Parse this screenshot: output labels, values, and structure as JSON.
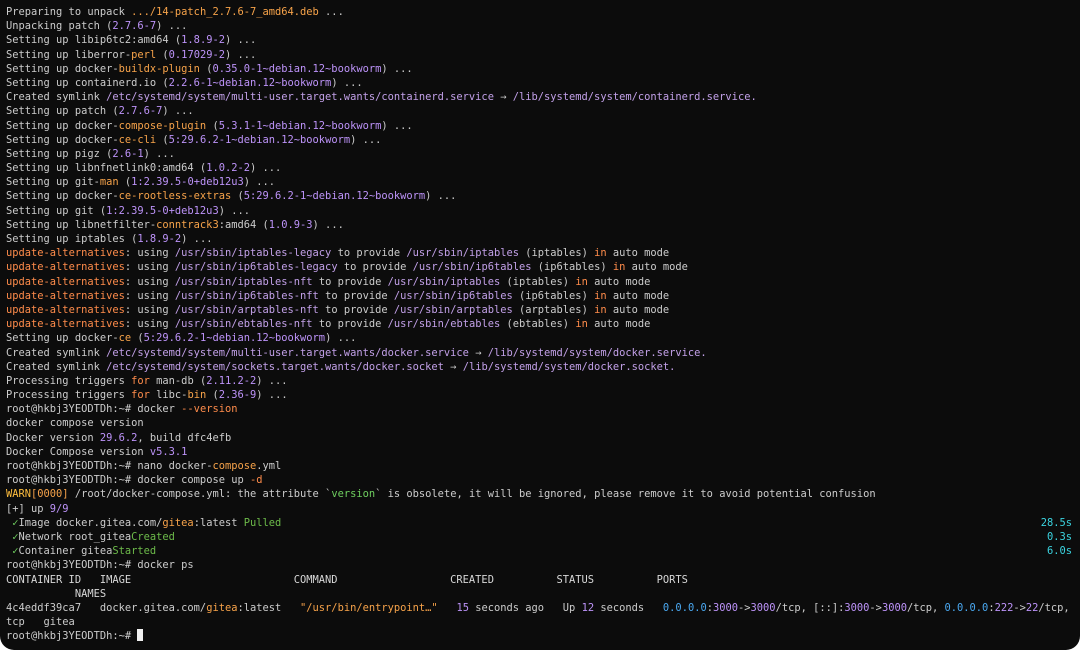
{
  "terminal": {
    "prompt": "root@hkbj3YEODTDh:~#",
    "lines": [
      [
        [
          "Preparing to unpack ",
          ""
        ],
        [
          ".../14-patch_2.7.6-7_amd64.deb",
          "hl"
        ],
        [
          " ...",
          ""
        ]
      ],
      [
        [
          "Unpacking patch (",
          ""
        ],
        [
          "2.7.6-7",
          "num"
        ],
        [
          ") ...",
          ""
        ]
      ],
      [
        [
          "Setting up libip6tc2:amd64 (",
          ""
        ],
        [
          "1.8.9-2",
          "num"
        ],
        [
          ") ...",
          ""
        ]
      ],
      [
        [
          "Setting up liberror-",
          ""
        ],
        [
          "perl",
          "hl"
        ],
        [
          " (",
          ""
        ],
        [
          "0.17029-2",
          "num"
        ],
        [
          ") ...",
          ""
        ]
      ],
      [
        [
          "Setting up docker-",
          ""
        ],
        [
          "buildx-plugin",
          "hl"
        ],
        [
          " (",
          ""
        ],
        [
          "0.35.0-1~debian.12~bookworm",
          "num"
        ],
        [
          ") ...",
          ""
        ]
      ],
      [
        [
          "Setting up containerd.io (",
          ""
        ],
        [
          "2.2.6-1~debian.12~bookworm",
          "num"
        ],
        [
          ") ...",
          ""
        ]
      ],
      [
        [
          "Created symlink ",
          ""
        ],
        [
          "/etc/systemd/system/multi-user.target.wants/containerd.service",
          "path"
        ],
        [
          " → ",
          ""
        ],
        [
          "/lib/systemd/system/containerd.service.",
          "path"
        ]
      ],
      [
        [
          "Setting up patch (",
          ""
        ],
        [
          "2.7.6-7",
          "num"
        ],
        [
          ") ...",
          ""
        ]
      ],
      [
        [
          "Setting up docker-",
          ""
        ],
        [
          "compose-plugin",
          "hl"
        ],
        [
          " (",
          ""
        ],
        [
          "5.3.1-1~debian.12~bookworm",
          "num"
        ],
        [
          ") ...",
          ""
        ]
      ],
      [
        [
          "Setting up docker-",
          ""
        ],
        [
          "ce-cli",
          "hl"
        ],
        [
          " (",
          ""
        ],
        [
          "5:29.6.2-1~debian.12~bookworm",
          "num"
        ],
        [
          ") ...",
          ""
        ]
      ],
      [
        [
          "Setting up pigz (",
          ""
        ],
        [
          "2.6-1",
          "num"
        ],
        [
          ") ...",
          ""
        ]
      ],
      [
        [
          "Setting up libnfnetlink0:amd64 (",
          ""
        ],
        [
          "1.0.2-2",
          "num"
        ],
        [
          ") ...",
          ""
        ]
      ],
      [
        [
          "Setting up git-",
          ""
        ],
        [
          "man",
          "hl"
        ],
        [
          " (",
          ""
        ],
        [
          "1:2.39.5-0+deb12u3",
          "num"
        ],
        [
          ") ...",
          ""
        ]
      ],
      [
        [
          "Setting up docker-",
          ""
        ],
        [
          "ce-rootless-extras",
          "hl"
        ],
        [
          " (",
          ""
        ],
        [
          "5:29.6.2-1~debian.12~bookworm",
          "num"
        ],
        [
          ") ...",
          ""
        ]
      ],
      [
        [
          "Setting up git (",
          ""
        ],
        [
          "1:2.39.5-0+deb12u3",
          "num"
        ],
        [
          ") ...",
          ""
        ]
      ],
      [
        [
          "Setting up libnetfilter-",
          ""
        ],
        [
          "conntrack3",
          "hl"
        ],
        [
          ":amd64 (",
          ""
        ],
        [
          "1.0.9-3",
          "num"
        ],
        [
          ") ...",
          ""
        ]
      ],
      [
        [
          "Setting up iptables (",
          ""
        ],
        [
          "1.8.9-2",
          "num"
        ],
        [
          ") ...",
          ""
        ]
      ],
      [
        [
          "update-",
          "kw"
        ],
        [
          "alternatives",
          "kw"
        ],
        [
          ": using ",
          ""
        ],
        [
          "/usr/sbin/iptables-legacy",
          "path"
        ],
        [
          " to provide ",
          ""
        ],
        [
          "/usr/sbin/iptables",
          "path"
        ],
        [
          " (iptables) ",
          ""
        ],
        [
          "in",
          "kw"
        ],
        [
          " auto mode",
          ""
        ]
      ],
      [
        [
          "update-",
          "kw"
        ],
        [
          "alternatives",
          "kw"
        ],
        [
          ": using ",
          ""
        ],
        [
          "/usr/sbin/ip6tables-legacy",
          "path"
        ],
        [
          " to provide ",
          ""
        ],
        [
          "/usr/sbin/ip6tables",
          "path"
        ],
        [
          " (ip6tables) ",
          ""
        ],
        [
          "in",
          "kw"
        ],
        [
          " auto mode",
          ""
        ]
      ],
      [
        [
          "update-",
          "kw"
        ],
        [
          "alternatives",
          "kw"
        ],
        [
          ": using ",
          ""
        ],
        [
          "/usr/sbin/iptables-nft",
          "path"
        ],
        [
          " to provide ",
          ""
        ],
        [
          "/usr/sbin/iptables",
          "path"
        ],
        [
          " (iptables) ",
          ""
        ],
        [
          "in",
          "kw"
        ],
        [
          " auto mode",
          ""
        ]
      ],
      [
        [
          "update-",
          "kw"
        ],
        [
          "alternatives",
          "kw"
        ],
        [
          ": using ",
          ""
        ],
        [
          "/usr/sbin/ip6tables-nft",
          "path"
        ],
        [
          " to provide ",
          ""
        ],
        [
          "/usr/sbin/ip6tables",
          "path"
        ],
        [
          " (ip6tables) ",
          ""
        ],
        [
          "in",
          "kw"
        ],
        [
          " auto mode",
          ""
        ]
      ],
      [
        [
          "update-",
          "kw"
        ],
        [
          "alternatives",
          "kw"
        ],
        [
          ": using ",
          ""
        ],
        [
          "/usr/sbin/arptables-nft",
          "path"
        ],
        [
          " to provide ",
          ""
        ],
        [
          "/usr/sbin/arptables",
          "path"
        ],
        [
          " (arptables) ",
          ""
        ],
        [
          "in",
          "kw"
        ],
        [
          " auto mode",
          ""
        ]
      ],
      [
        [
          "update-",
          "kw"
        ],
        [
          "alternatives",
          "kw"
        ],
        [
          ": using ",
          ""
        ],
        [
          "/usr/sbin/ebtables-nft",
          "path"
        ],
        [
          " to provide ",
          ""
        ],
        [
          "/usr/sbin/ebtables",
          "path"
        ],
        [
          " (ebtables) ",
          ""
        ],
        [
          "in",
          "kw"
        ],
        [
          " auto mode",
          ""
        ]
      ],
      [
        [
          "Setting up docker-",
          ""
        ],
        [
          "ce",
          "hl"
        ],
        [
          " (",
          ""
        ],
        [
          "5:29.6.2-1~debian.12~bookworm",
          "num"
        ],
        [
          ") ...",
          ""
        ]
      ],
      [
        [
          "Created symlink ",
          ""
        ],
        [
          "/etc/systemd/system/multi-user.target.wants/docker.service",
          "path"
        ],
        [
          " → ",
          ""
        ],
        [
          "/lib/systemd/system/docker.service.",
          "path"
        ]
      ],
      [
        [
          "Created symlink ",
          ""
        ],
        [
          "/etc/systemd/system/sockets.target.wants/docker.socket",
          "path"
        ],
        [
          " → ",
          ""
        ],
        [
          "/lib/systemd/system/docker.socket.",
          "path"
        ]
      ],
      [
        [
          "Processing triggers ",
          ""
        ],
        [
          "for",
          "kw"
        ],
        [
          " man-db (",
          ""
        ],
        [
          "2.11.2-2",
          "num"
        ],
        [
          ") ...",
          ""
        ]
      ],
      [
        [
          "Processing triggers ",
          ""
        ],
        [
          "for",
          "kw"
        ],
        [
          " libc-",
          ""
        ],
        [
          "bin",
          "hl"
        ],
        [
          " (",
          ""
        ],
        [
          "2.36-9",
          "num"
        ],
        [
          ") ...",
          ""
        ]
      ],
      [
        [
          "root@hkbj3YEODTDh:~# ",
          ""
        ],
        [
          "docker ",
          ""
        ],
        [
          "--version",
          "kw"
        ]
      ],
      [
        [
          "docker compose version",
          ""
        ]
      ],
      [
        [
          "Docker version ",
          ""
        ],
        [
          "29.6.2",
          "num"
        ],
        [
          ", build dfc4efb",
          ""
        ]
      ],
      [
        [
          "Docker Compose version ",
          ""
        ],
        [
          "v5.3.1",
          "num"
        ]
      ],
      [
        [
          "root@hkbj3YEODTDh:~# ",
          ""
        ],
        [
          "nano docker-",
          ""
        ],
        [
          "compose",
          "hl"
        ],
        [
          ".yml",
          ""
        ]
      ],
      [
        [
          "root@hkbj3YEODTDh:~# ",
          ""
        ],
        [
          "docker compose up ",
          ""
        ],
        [
          "-d",
          "kw"
        ]
      ],
      [
        [
          "WARN",
          "warn"
        ],
        [
          "[0000]",
          "hl"
        ],
        [
          " /root/docker-compose.yml: the attribute `",
          ""
        ],
        [
          "version",
          "green"
        ],
        [
          "` is obsolete, it will be ignored, please remove it to avoid potential confusion",
          ""
        ]
      ],
      [
        [
          "[+] up ",
          ""
        ],
        [
          "9/9",
          "num"
        ]
      ],
      [
        [
          " ✓",
          "green"
        ],
        [
          "Image docker.gitea.com/",
          ""
        ],
        [
          "gitea",
          "hl"
        ],
        [
          ":latest ",
          ""
        ],
        [
          "Pulled",
          "dim"
        ]
      ],
      [
        [
          " ✓",
          "green"
        ],
        [
          "Network root_gitea",
          ""
        ],
        [
          "Created",
          "dim"
        ]
      ],
      [
        [
          " ✓",
          "green"
        ],
        [
          "Container gitea",
          ""
        ],
        [
          "Started",
          "dim"
        ]
      ],
      [
        [
          "root@hkbj3YEODTDh:~# ",
          ""
        ],
        [
          "docker ps",
          ""
        ]
      ],
      [
        [
          "CONTAINER ID   IMAGE                          COMMAND                  CREATED          STATUS          PORTS",
          "head"
        ]
      ],
      [
        [
          "           NAMES",
          "head"
        ]
      ],
      [
        [
          "4c4eddf39ca7   docker.gitea.com/",
          ""
        ],
        [
          "gitea",
          "hl"
        ],
        [
          ":latest   ",
          ""
        ],
        [
          "\"/usr/bin/entrypoint…\"",
          "hl"
        ],
        [
          "   ",
          ""
        ],
        [
          "15",
          "num"
        ],
        [
          " seconds ago   Up ",
          ""
        ],
        [
          "12",
          "num"
        ],
        [
          " seconds   ",
          ""
        ],
        [
          "0.0.0.0",
          "port"
        ],
        [
          ":",
          ""
        ],
        [
          "3000",
          "num"
        ],
        [
          "->",
          ""
        ],
        [
          "3000",
          "num"
        ],
        [
          "/tcp, [::]:",
          ""
        ],
        [
          "3000",
          "num"
        ],
        [
          "->",
          ""
        ],
        [
          "3000",
          "num"
        ],
        [
          "/tcp, ",
          ""
        ],
        [
          "0.0.0.0",
          "port"
        ],
        [
          ":",
          ""
        ],
        [
          "222",
          "num"
        ],
        [
          "->",
          ""
        ],
        [
          "22",
          "num"
        ],
        [
          "/tcp, [::]:",
          ""
        ],
        [
          "222",
          "num"
        ],
        [
          "->",
          ""
        ],
        [
          "22",
          "num"
        ],
        [
          "/",
          ""
        ]
      ],
      [
        [
          "tcp   gitea",
          ""
        ]
      ],
      [
        [
          "root@hkbj3YEODTDh:~# ",
          ""
        ]
      ]
    ],
    "durations": {
      "36": "28.5s",
      "37": "0.3s",
      "38": "6.0s"
    }
  }
}
